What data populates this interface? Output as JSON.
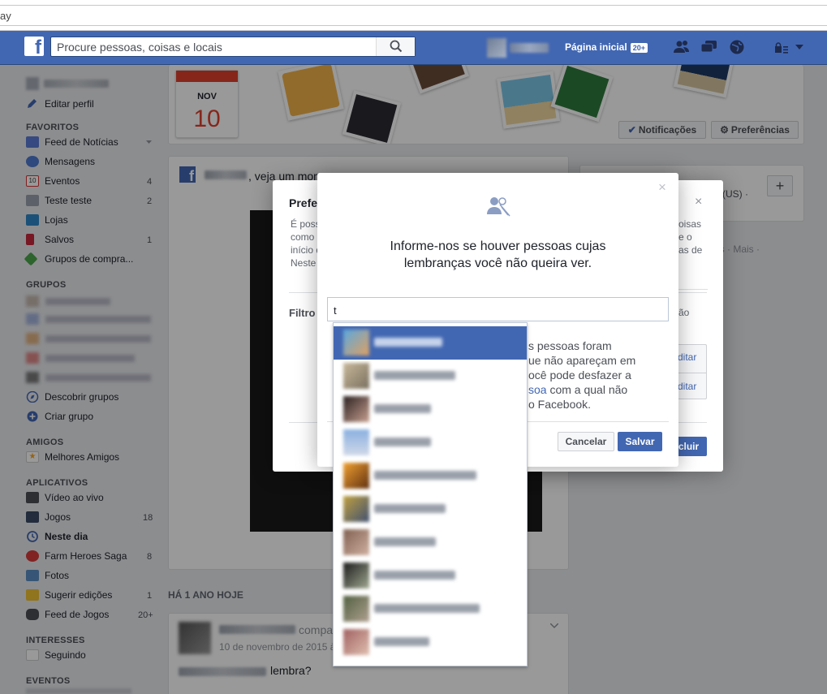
{
  "browser": {
    "url_fragment": "ay"
  },
  "topbar": {
    "search_placeholder": "Procure pessoas, coisas e locais",
    "home_label": "Página inicial",
    "home_badge": "20+",
    "logo": "f"
  },
  "sidebar": {
    "edit_profile": "Editar perfil",
    "favorites_header": "FAVORITOS",
    "favorites": [
      {
        "label": "Feed de Notícias",
        "count": ""
      },
      {
        "label": "Mensagens",
        "count": ""
      },
      {
        "label": "Eventos",
        "count": "4"
      },
      {
        "label": "Teste teste",
        "count": "2"
      },
      {
        "label": "Lojas",
        "count": ""
      },
      {
        "label": "Salvos",
        "count": "1"
      },
      {
        "label": "Grupos de compra...",
        "count": ""
      }
    ],
    "groups_header": "GRUPOS",
    "discover_groups": "Descobrir grupos",
    "create_group": "Criar grupo",
    "friends_header": "AMIGOS",
    "best_friends": "Melhores Amigos",
    "apps_header": "APLICATIVOS",
    "apps": [
      {
        "label": "Vídeo ao vivo",
        "count": ""
      },
      {
        "label": "Jogos",
        "count": "18"
      },
      {
        "label": "Neste dia",
        "count": ""
      },
      {
        "label": "Farm Heroes Saga",
        "count": "8"
      },
      {
        "label": "Fotos",
        "count": ""
      },
      {
        "label": "Sugerir edições",
        "count": "1"
      },
      {
        "label": "Feed de Jogos",
        "count": "20+"
      }
    ],
    "interests_header": "INTERESSES",
    "following": "Seguindo",
    "events_header": "EVENTOS"
  },
  "header_banner": {
    "month": "NOV",
    "day": "10",
    "notifications_btn": "Notificações",
    "preferences_btn": "Preferências"
  },
  "memory_card": {
    "text": ", veja um mom"
  },
  "year_section": {
    "title": "HÁ 1 ANO HOJE",
    "shared": "compa",
    "date": "10 de novembro de 2015 à",
    "caption": "lembra?"
  },
  "right_col": {
    "lang": "(US) ·",
    "more": "es · Mais ·",
    "plus": "+"
  },
  "prefs_dialog": {
    "title": "Prefe",
    "body_lines": [
      "É poss",
      "como p",
      "início d",
      "Neste"
    ],
    "filters_label": "Filtro",
    "right_frag_lines": [
      "oisas",
      "e o",
      "as de"
    ],
    "side_frag": "ão",
    "edit1": "ditar",
    "edit2": "ditar",
    "include_btn": "cluir"
  },
  "modal": {
    "heading_line1": "Informe-nos se houver pessoas cujas",
    "heading_line2": "lembranças você não queira ver.",
    "input_value": "t",
    "info_line1": "s pessoas foram",
    "info_line2": "ue não apareçam em",
    "info_line3": "ocê pode desfazer a",
    "info_link": "soa",
    "info_line4_rest": " com a qual não",
    "info_line5": "o Facebook.",
    "cancel_btn": "Cancelar",
    "save_btn": "Salvar",
    "close": "×"
  },
  "colors": {
    "fb_blue": "#4267b2",
    "bg": "#e9ebee",
    "highlight": "#4267b2"
  },
  "icons": [
    "search-icon",
    "friends-icon",
    "messages-icon",
    "globe-icon",
    "privacy-icon",
    "chevron-down-icon",
    "people-icon",
    "check-icon",
    "gear-icon",
    "close-icon"
  ]
}
